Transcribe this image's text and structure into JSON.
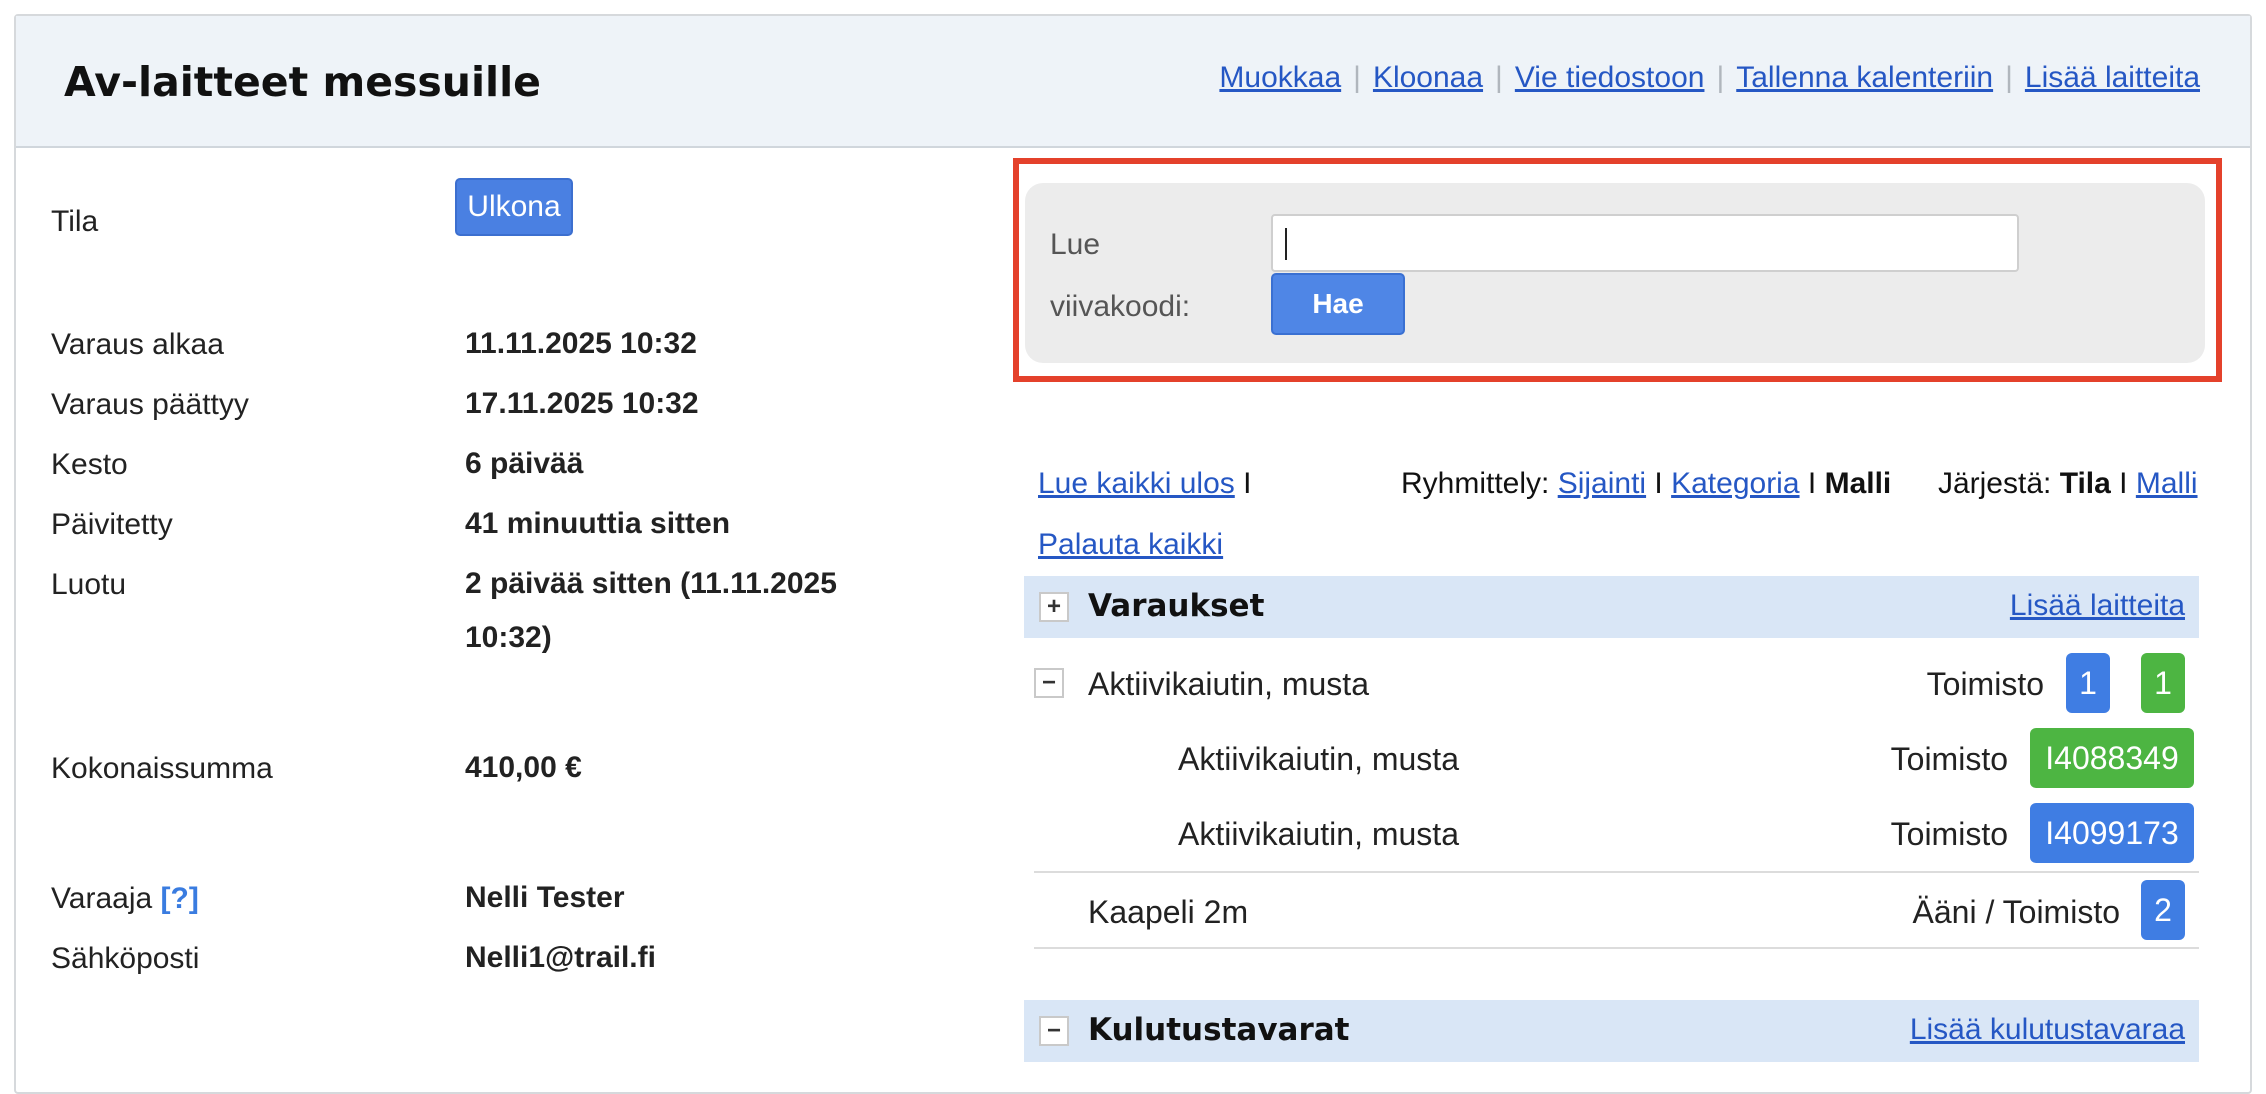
{
  "header": {
    "title": "Av-laitteet messuille",
    "links": [
      "Muokkaa",
      "Kloonaa",
      "Vie tiedostoon",
      "Tallenna kalenteriin",
      "Lisää laitteita"
    ]
  },
  "info": {
    "state_label": "Tila",
    "state_value": "Ulkona",
    "start_label": "Varaus alkaa",
    "start_value": "11.11.2025 10:32",
    "end_label": "Varaus päättyy",
    "end_value": "17.11.2025 10:32",
    "duration_label": "Kesto",
    "duration_value": "6 päivää",
    "updated_label": "Päivitetty",
    "updated_value": "41 minuuttia sitten",
    "created_label": "Luotu",
    "created_value_line1": "2 päivää sitten (11.11.2025",
    "created_value_line2": "10:32)",
    "total_label": "Kokonaissumma",
    "total_value": "410,00 €",
    "booker_label": "Varaaja",
    "booker_help": "[?]",
    "booker_value": "Nelli Tester",
    "email_label": "Sähköposti",
    "email_value": "Nelli1@trail.fi"
  },
  "barcode": {
    "label_line1": "Lue",
    "label_line2": "viivakoodi:",
    "input_value": "",
    "button_label": "Hae"
  },
  "controls": {
    "checkout_all": "Lue kaikki ulos",
    "return_all": "Palauta kaikki",
    "bar": "I",
    "grouping_label": "Ryhmittely:",
    "grouping_options": [
      "Sijainti",
      "Kategoria",
      "Malli"
    ],
    "sort_label": "Järjestä:",
    "sort_options": [
      "Tila",
      "Malli"
    ]
  },
  "groups": {
    "reservations": {
      "title": "Varaukset",
      "toggle": "+",
      "link": "Lisää laitteita"
    },
    "consumables": {
      "title": "Kulutustavarat",
      "toggle": "−",
      "link": "Lisää kulutustavaraa"
    }
  },
  "items": [
    {
      "toggle": "−",
      "name": "Aktiivikaiutin, musta",
      "location": "Toimisto",
      "badge1": "1",
      "badge2": "1"
    },
    {
      "name": "Aktiivikaiutin, musta",
      "location": "Toimisto",
      "code": "I4088349",
      "color": "#4db542"
    },
    {
      "name": "Aktiivikaiutin, musta",
      "location": "Toimisto",
      "code": "I4099173",
      "color": "#3f7de3"
    },
    {
      "name": "Kaapeli 2m",
      "location": "Ääni / Toimisto",
      "badge": "2"
    }
  ],
  "colors": {
    "accent_blue": "#3f7de3",
    "accent_green": "#4db542",
    "highlight_red": "#e4412b",
    "group_bar": "#d9e6f6"
  }
}
